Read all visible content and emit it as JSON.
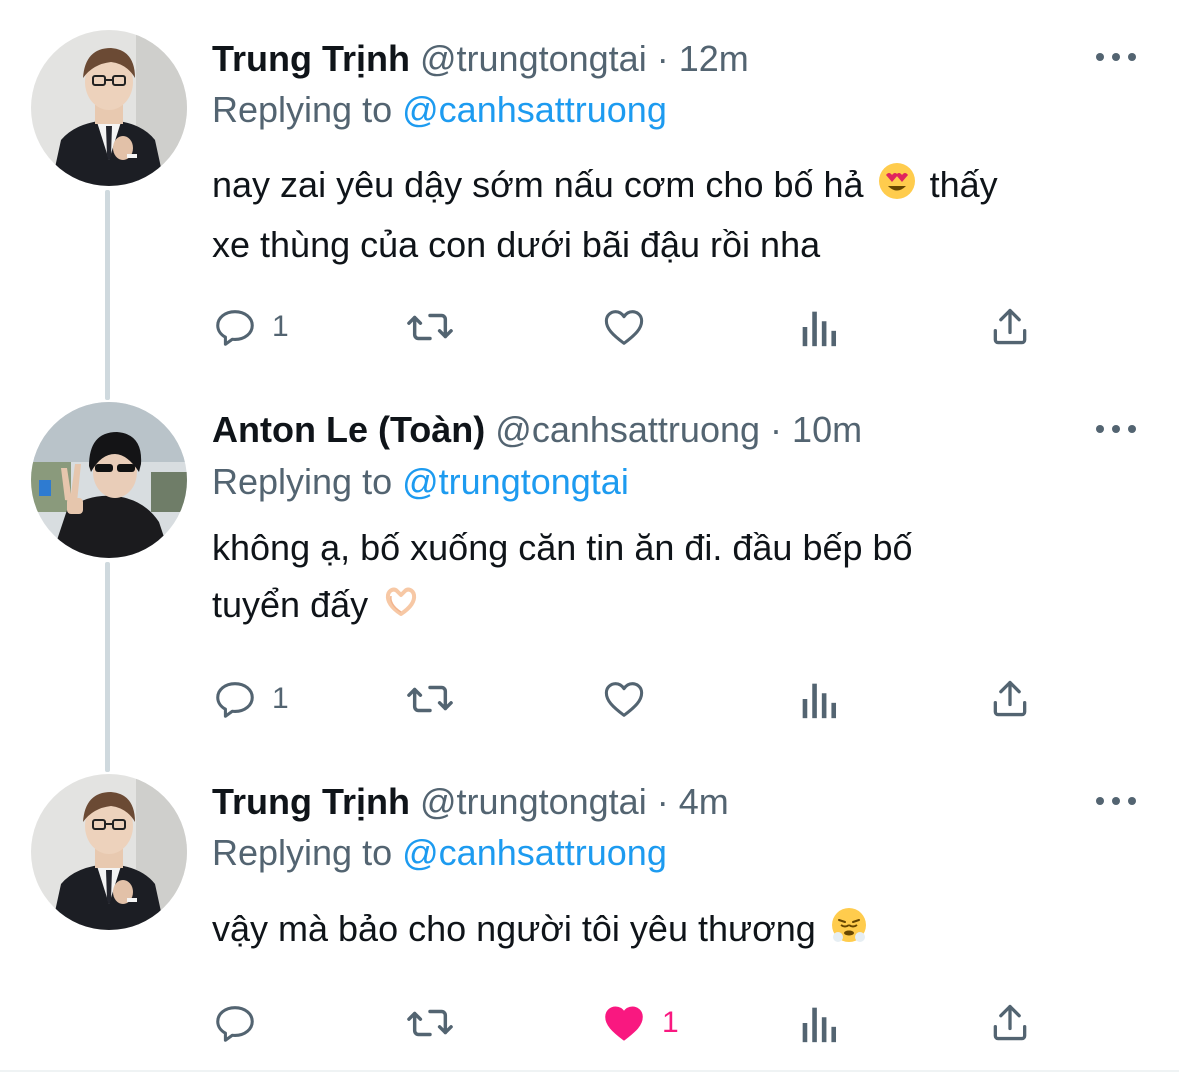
{
  "colors": {
    "accent": "#1d9bf0",
    "muted": "#536471",
    "text": "#0f1419",
    "like": "#f91880",
    "thread_line": "#cfd9de"
  },
  "tweets": [
    {
      "name": "Trung Trịnh",
      "handle": "@trungtongtai",
      "dot": "·",
      "time": "12m",
      "replying_label": "Replying to",
      "replying_to": "@canhsattruong",
      "text_line1": "nay zai yêu dậy sớm nấu cơm cho bố hả",
      "emoji1": "heart-eyes-emoji",
      "text_line1_after": "thấy",
      "text_line2": "xe thùng của con dưới bãi đậu rồi nha",
      "reply_count": "1",
      "retweet_count": "",
      "like_count": "",
      "liked": false,
      "avatar": "avatar-trung"
    },
    {
      "name": "Anton Le (Toàn)",
      "handle": "@canhsattruong",
      "dot": "·",
      "time": "10m",
      "replying_label": "Replying to",
      "replying_to": "@trungtongtai",
      "text_line1": "không ạ, bố xuống căn tin ăn đi. đầu bếp bố",
      "text_line2": "tuyển đấy",
      "emoji2": "heart-hands-emoji",
      "reply_count": "1",
      "retweet_count": "",
      "like_count": "",
      "liked": false,
      "avatar": "avatar-anton"
    },
    {
      "name": "Trung Trịnh",
      "handle": "@trungtongtai",
      "dot": "·",
      "time": "4m",
      "replying_label": "Replying to",
      "replying_to": "@canhsattruong",
      "text_line1": "vậy mà bảo cho người tôi yêu thương",
      "emoji1": "steam-nose-emoji",
      "reply_count": "",
      "retweet_count": "",
      "like_count": "1",
      "liked": true,
      "avatar": "avatar-trung"
    }
  ]
}
